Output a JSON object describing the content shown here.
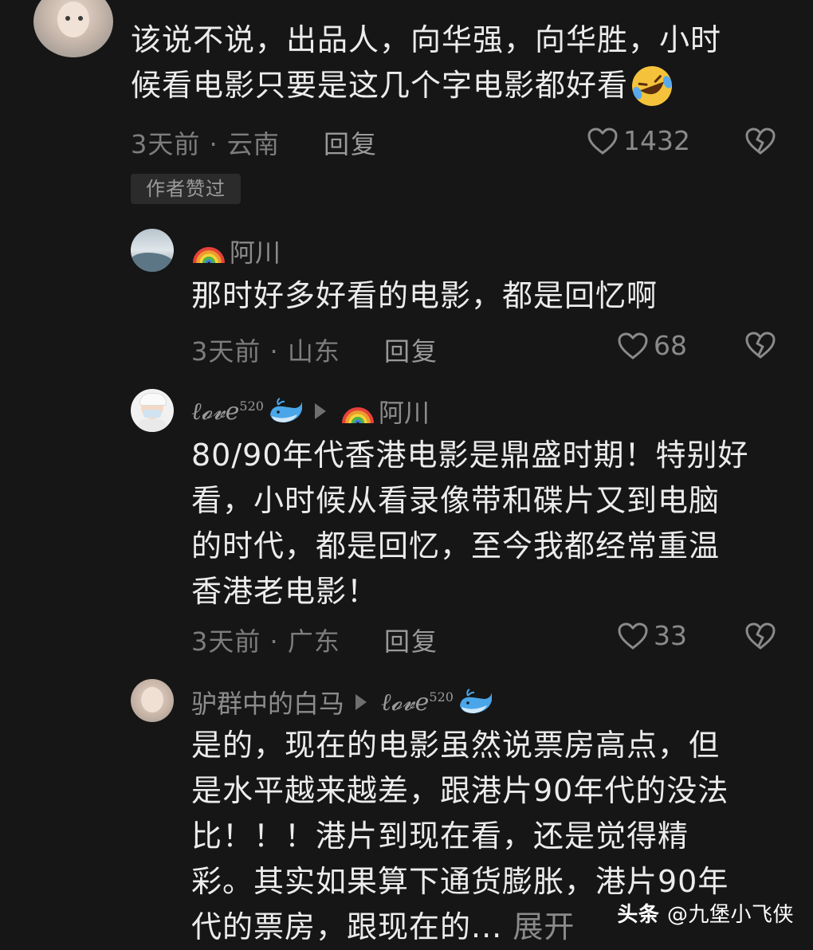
{
  "comment": {
    "line1": "该说不说，出品人，向华强，向华胜，小时",
    "line2": "候看电影只要是这几个字电影都好看",
    "meta": "3天前 · 云南",
    "reply_label": "回复",
    "likes": "1432",
    "badge": "作者赞过"
  },
  "replies": [
    {
      "user": "阿川",
      "lines": [
        "那时好多好看的电影，都是回忆啊"
      ],
      "meta": "3天前 · 山东",
      "reply_label": "回复",
      "likes": "68"
    },
    {
      "user": "ℓ𝓸𝓿e",
      "user_sup": "520",
      "reply_to": "阿川",
      "lines": [
        "80/90年代香港电影是鼎盛时期！特别好",
        "看，小时候从看录像带和碟片又到电脑",
        "的时代，都是回忆，至今我都经常重温",
        "香港老电影！"
      ],
      "meta": "3天前 · 广东",
      "reply_label": "回复",
      "likes": "33"
    },
    {
      "user": "驴群中的白马",
      "reply_to": "ℓ𝓸𝓿e",
      "reply_to_sup": "520",
      "lines": [
        "是的，现在的电影虽然说票房高点，但",
        "是水平越来越差，跟港片90年代的没法",
        "比！！！港片到现在看，还是觉得精",
        "彩。其实如果算下通货膨胀，港片90年",
        "代的票房，跟现在的..."
      ],
      "expand_label": "展开"
    }
  ],
  "watermark": {
    "brand": "头条",
    "handle": "@九堡小飞侠"
  },
  "icons": {
    "like": "heart-outline-icon",
    "dislike": "broken-heart-icon",
    "rainbow": "rainbow-emoji",
    "whale": "whale-emoji",
    "laugh": "rolling-laughing-emoji",
    "arrow": "reply-arrow-icon"
  }
}
